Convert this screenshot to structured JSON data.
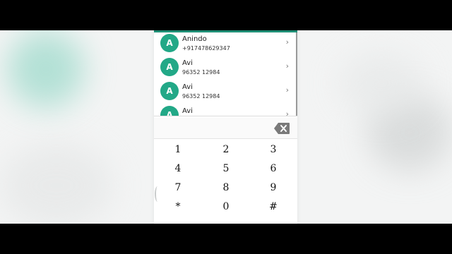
{
  "contacts": [
    {
      "initial": "A",
      "name": "Anindo",
      "number": "+917478629347"
    },
    {
      "initial": "A",
      "name": "Avi",
      "number": "96352 12984"
    },
    {
      "initial": "A",
      "name": "Avi",
      "number": "96352 12984"
    },
    {
      "initial": "A",
      "name": "Avi",
      "number": ""
    }
  ],
  "chevron": "›",
  "dial_input": {
    "value": ""
  },
  "keypad": {
    "k1": "1",
    "k2": "2",
    "k3": "3",
    "k4": "4",
    "k5": "5",
    "k6": "6",
    "k7": "7",
    "k8": "8",
    "k9": "9",
    "kstar": "*",
    "k0": "0",
    "khash": "#"
  },
  "colors": {
    "accent": "#22a887",
    "appbar": "#1f8f76"
  }
}
